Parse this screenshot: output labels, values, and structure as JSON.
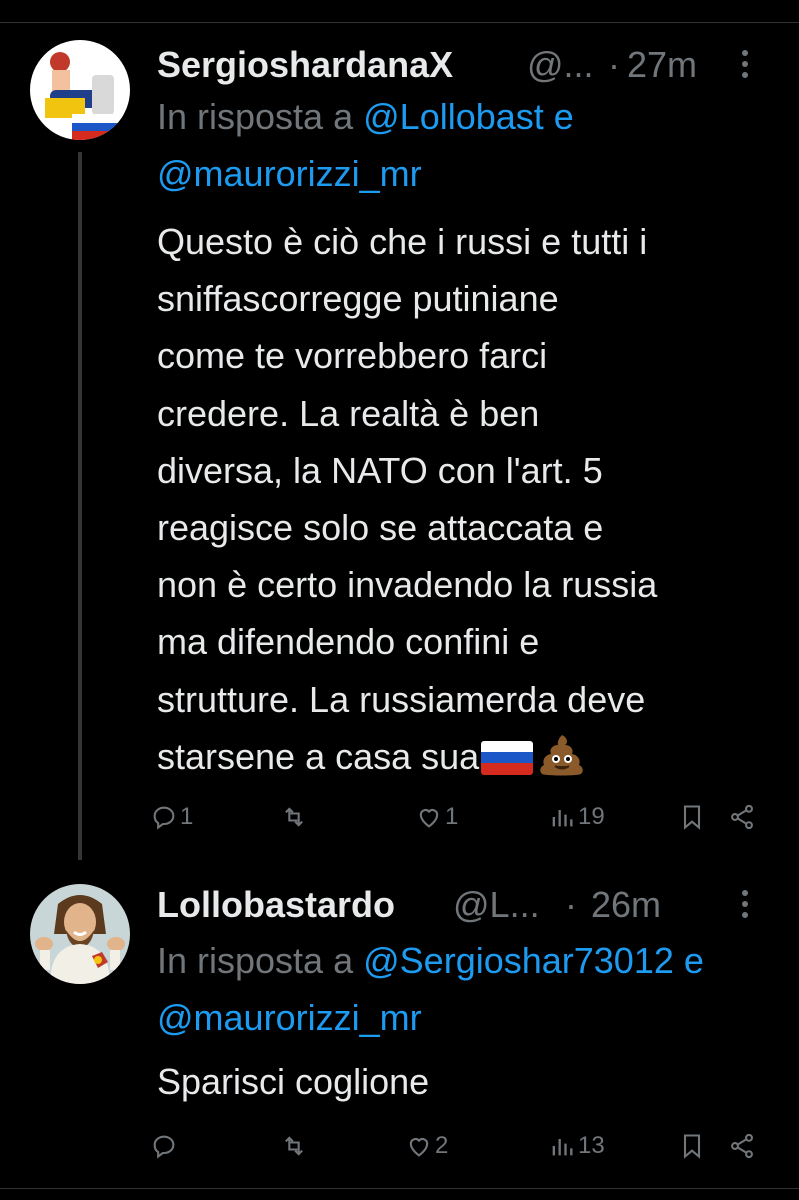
{
  "tweets": [
    {
      "display_name": "SergioshardanaX",
      "handle": "@...",
      "separator": "·",
      "time": "27m",
      "reply_prefix": "In risposta a",
      "reply_mention_1": "@Lollobast e",
      "reply_mention_2": "@maurorizzi_mr",
      "body_lines": [
        "Questo è ciò che i russi e tutti i",
        "sniffascorregge putiniane",
        "come te vorrebbero farci",
        "credere. La realtà è ben",
        "diversa, la NATO con l'art. 5",
        "reagisce solo se attaccata e",
        "non è certo invadendo la russia",
        "ma difendendo confini e",
        "strutture. La russiamerda deve",
        "starsene a casa sua"
      ],
      "body_emojis": [
        "russian-flag",
        "pile-of-poo"
      ],
      "replies": "1",
      "retweets": "",
      "likes": "1",
      "views": "19"
    },
    {
      "display_name": "Lollobastardo",
      "handle": "@L...",
      "separator": "·",
      "time": "26m",
      "reply_prefix": "In risposta a",
      "reply_mention_1": "@Sergioshar73012 e",
      "reply_mention_2": "@maurorizzi_mr",
      "body_lines": [
        "Sparisci coglione"
      ],
      "replies": "",
      "retweets": "",
      "likes": "2",
      "views": "13"
    }
  ],
  "colors": {
    "background": "#000000",
    "text": "#e7e9ea",
    "secondary": "#71767b",
    "mention": "#1d9bf0",
    "divider": "#2f3336"
  },
  "icons": [
    "reply-icon",
    "retweet-icon",
    "like-icon",
    "views-icon",
    "bookmark-icon",
    "share-icon",
    "more-icon"
  ]
}
